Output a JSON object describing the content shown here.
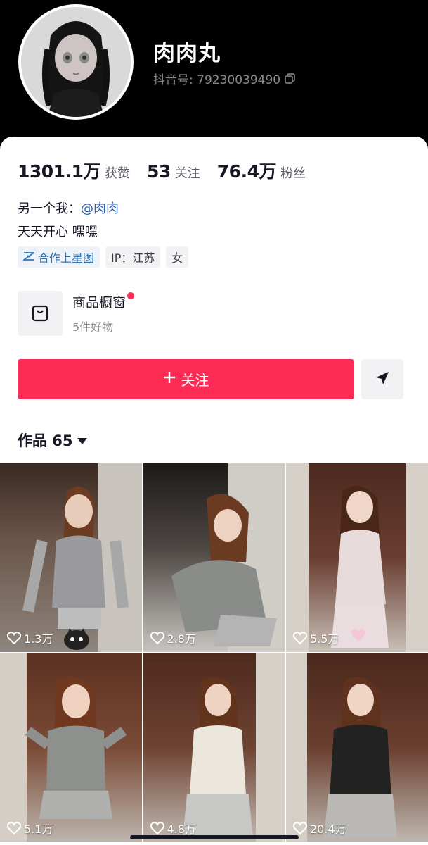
{
  "profile": {
    "nickname": "肉肉丸",
    "douyin_id": "抖音号: 79230039490"
  },
  "stats": [
    {
      "value": "1301.1万",
      "label": "获赞"
    },
    {
      "value": "53",
      "label": "关注"
    },
    {
      "value": "76.4万",
      "label": "粉丝"
    }
  ],
  "bio": {
    "line1_prefix": "另一个我：",
    "line1_mention": "@肉肉",
    "line2": "天天开心 嘿嘿"
  },
  "tags": {
    "xingtu": "合作上星图",
    "ip": "IP：江苏",
    "gender": "女"
  },
  "shop": {
    "title": "商品橱窗",
    "subtitle": "5件好物"
  },
  "actions": {
    "follow_label": "关注"
  },
  "works": {
    "label": "作品 65"
  },
  "videos": [
    {
      "likes": "1.3万"
    },
    {
      "likes": "2.8万"
    },
    {
      "likes": "5.5万"
    },
    {
      "likes": "5.1万"
    },
    {
      "likes": "4.8万"
    },
    {
      "likes": "20.4万"
    }
  ],
  "colors": {
    "accent": "#fe2c55",
    "link": "#2a5db0",
    "header_bg": "#000000"
  }
}
